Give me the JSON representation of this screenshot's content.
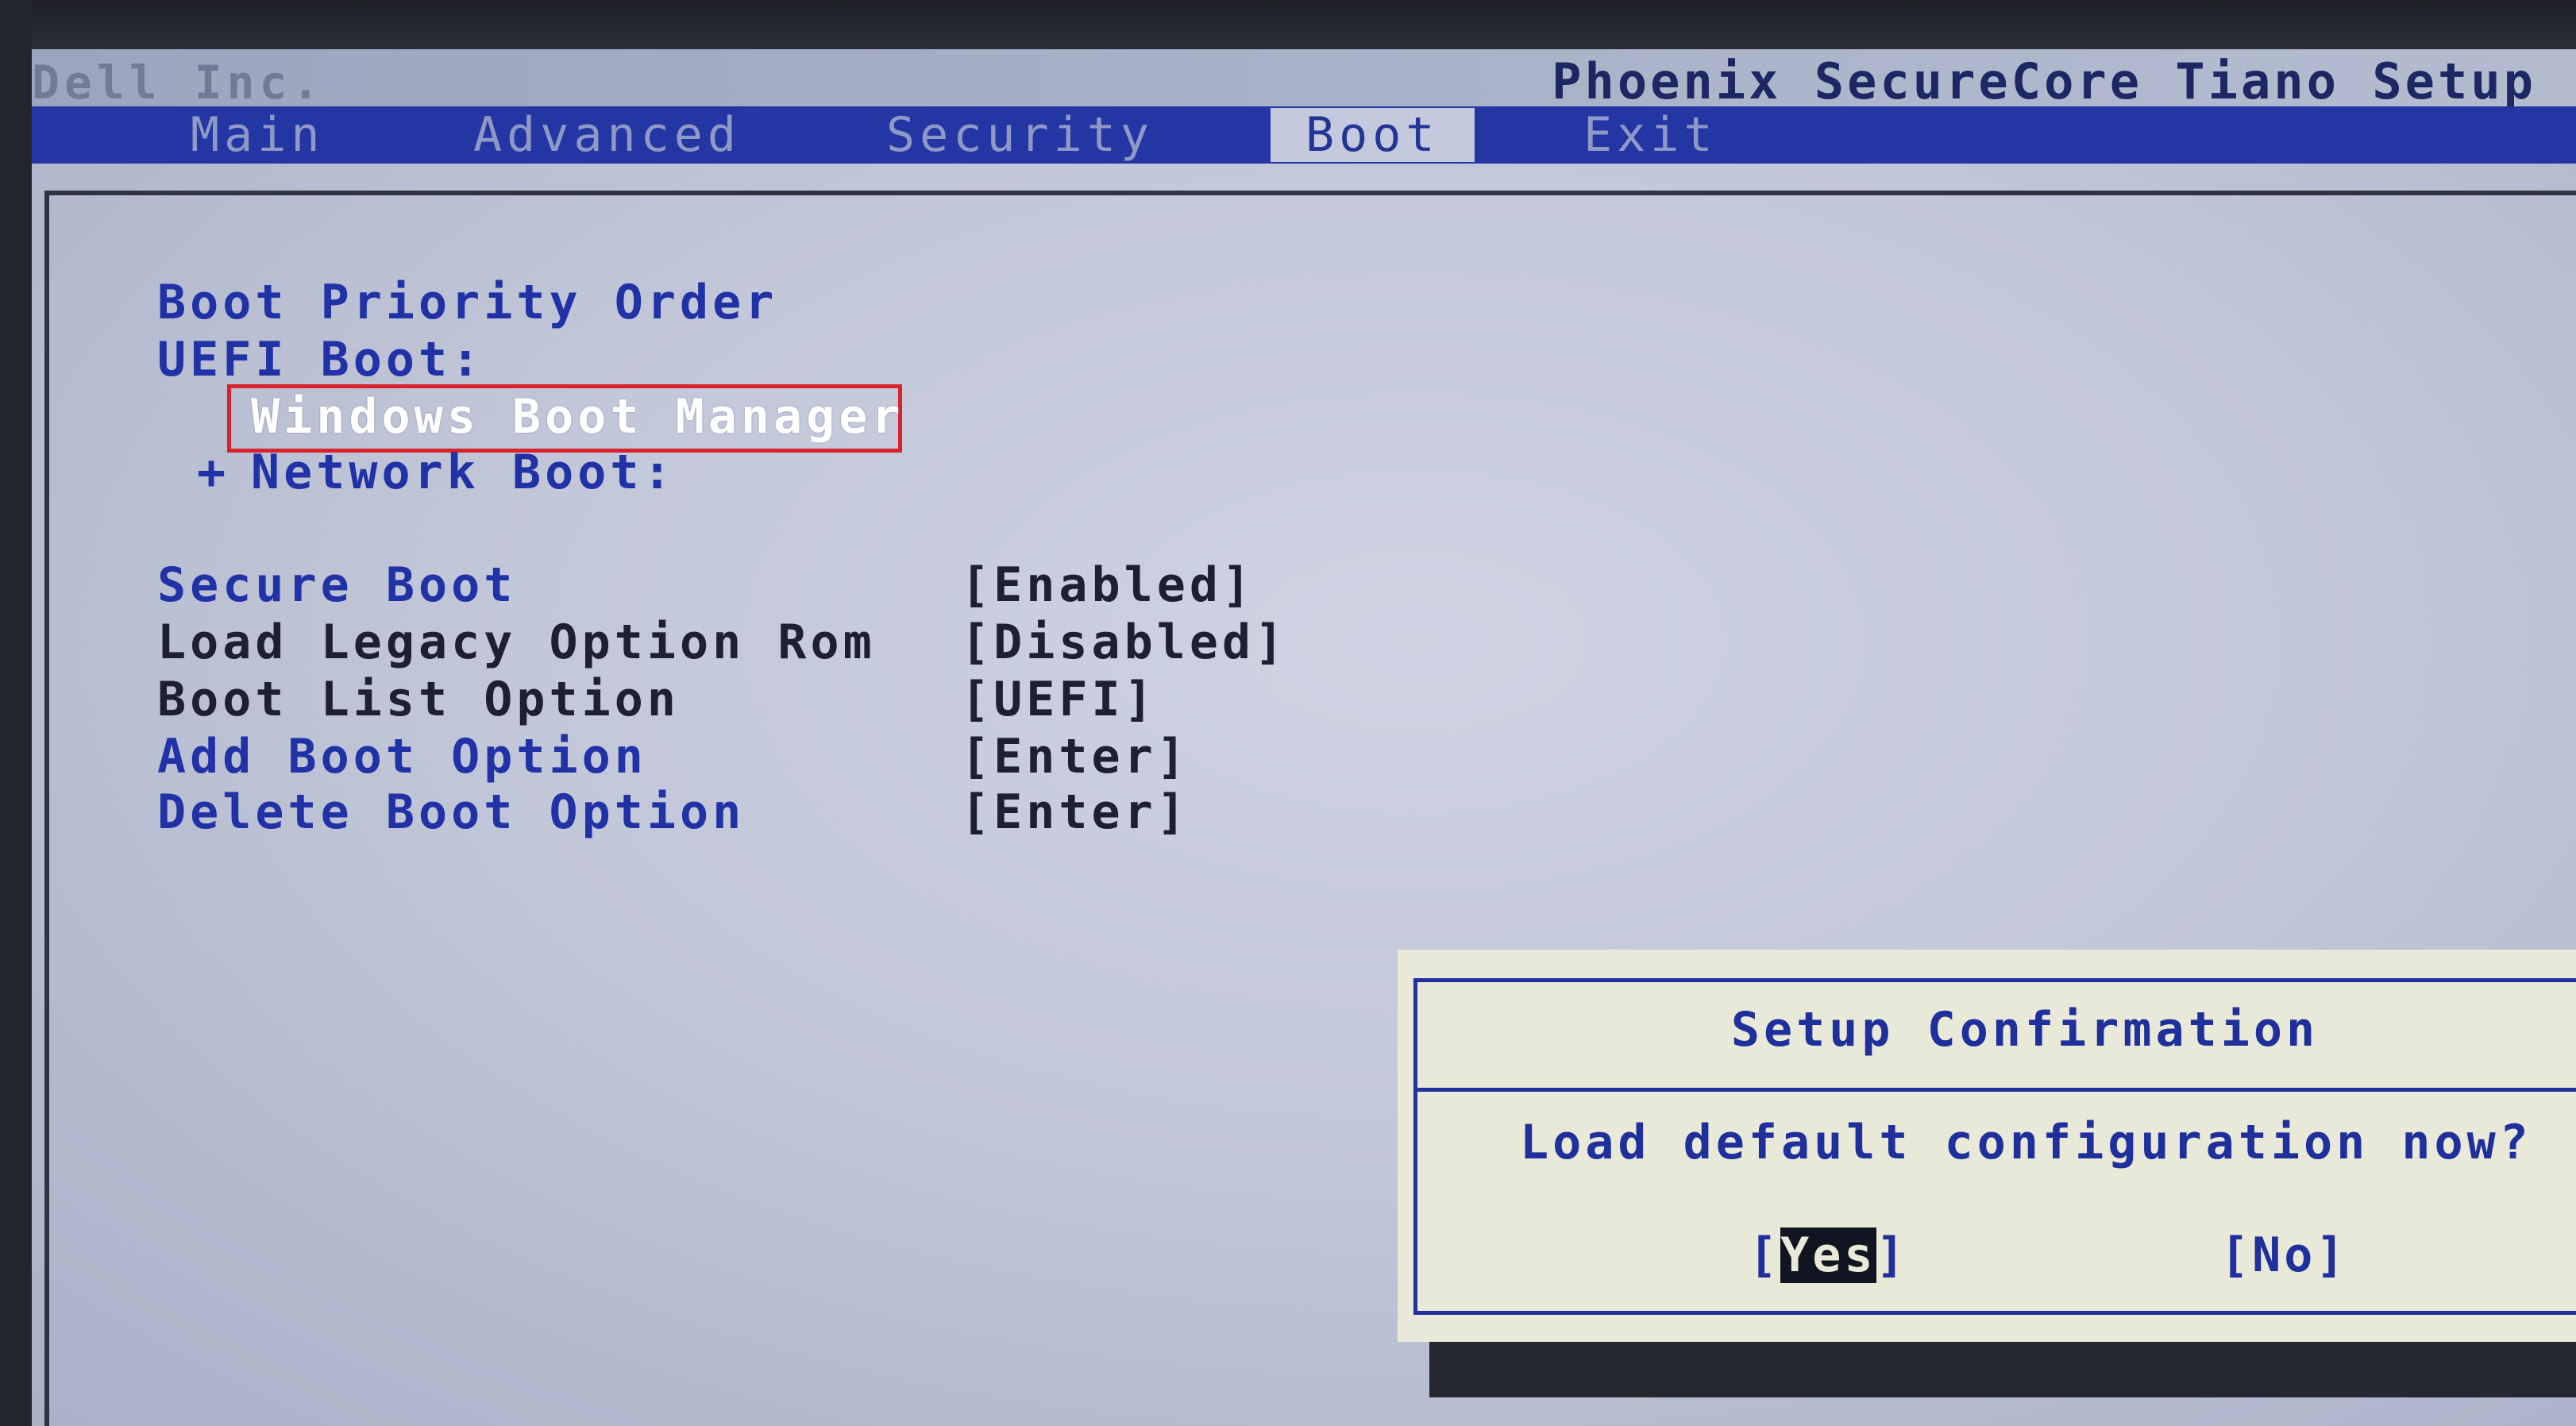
{
  "header": {
    "vendor": "Dell Inc.",
    "product": "Phoenix SecureCore Tiano Setup"
  },
  "menu": {
    "tabs": [
      {
        "label": "Main"
      },
      {
        "label": "Advanced"
      },
      {
        "label": "Security"
      },
      {
        "label": "Boot",
        "active": true
      },
      {
        "label": "Exit"
      }
    ]
  },
  "boot": {
    "priority_heading": "Boot Priority Order",
    "uefi_heading": "UEFI Boot:",
    "windows_boot_manager": "Windows Boot Manager",
    "network_boot_prefix": "+",
    "network_boot": "Network Boot:",
    "settings": [
      {
        "label": "Secure Boot",
        "value": "[Enabled]"
      },
      {
        "label": "Load Legacy Option Rom",
        "value": "[Disabled]"
      },
      {
        "label": "Boot List Option",
        "value": "[UEFI]"
      },
      {
        "label": "Add Boot Option",
        "value": "[Enter]"
      },
      {
        "label": "Delete Boot Option",
        "value": "[Enter]"
      }
    ]
  },
  "dialog": {
    "title": "Setup Confirmation",
    "message": "Load default configuration now?",
    "yes_open": "[",
    "yes_label": "Yes",
    "yes_close": "]",
    "no_label": "[No]"
  },
  "colors": {
    "menu_bar": "#2336a3",
    "link_text": "#2131a6",
    "selection_outline": "#d8232d",
    "dialog_bg": "#e9e9d9"
  }
}
